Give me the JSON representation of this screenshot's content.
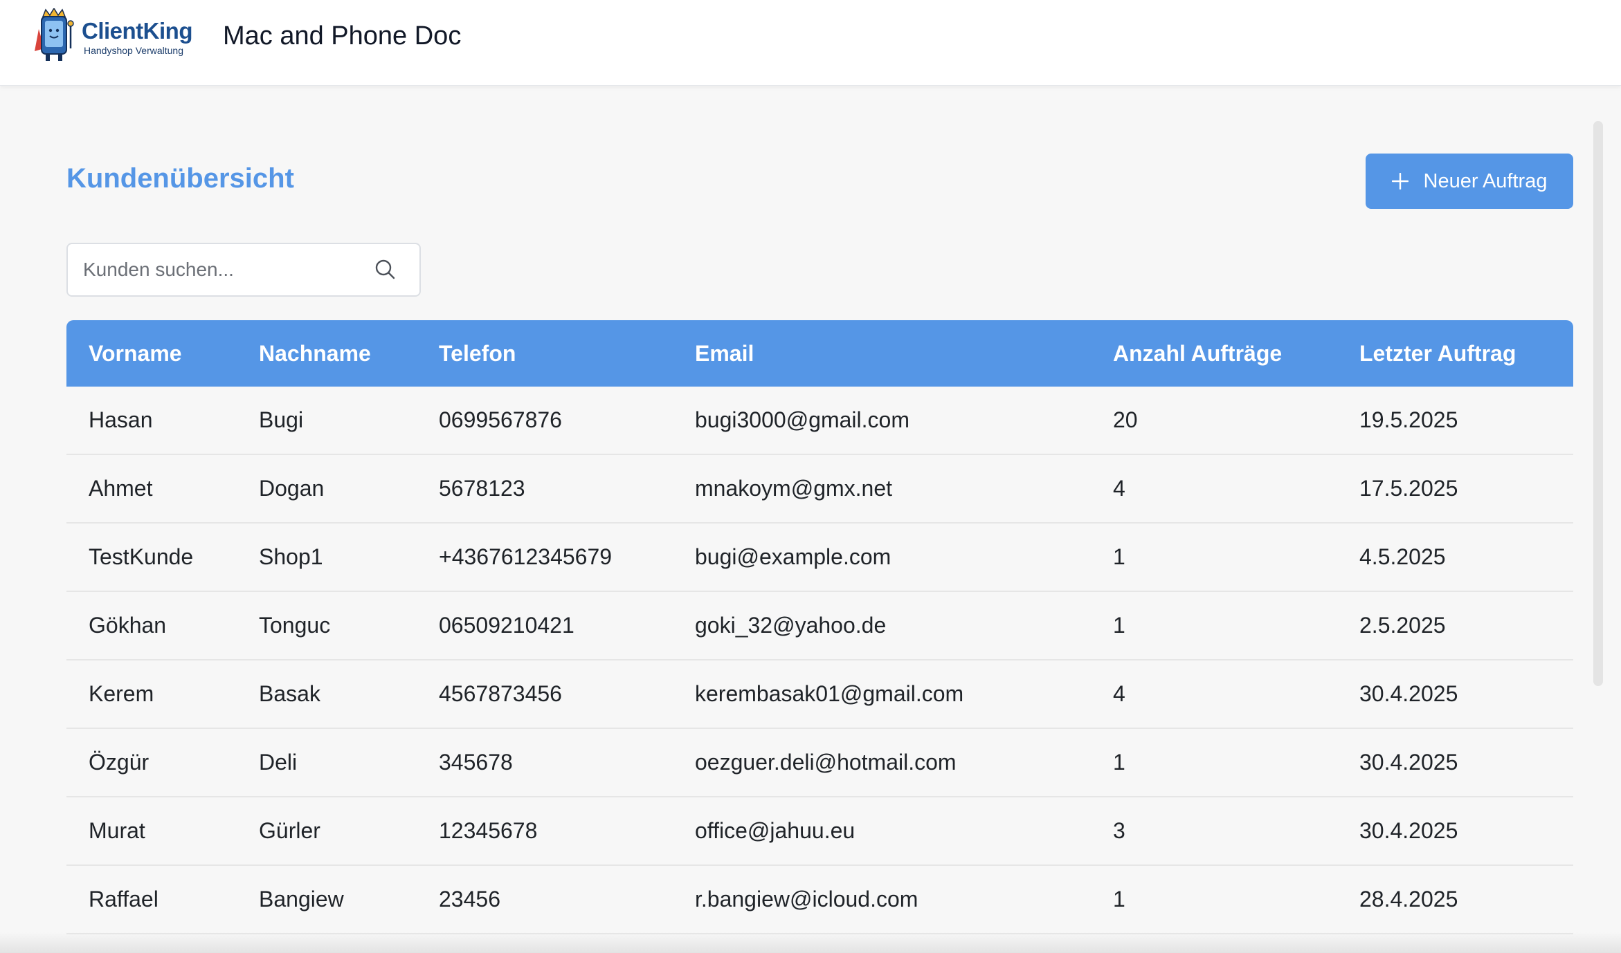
{
  "brand": {
    "name": "ClientKing",
    "tagline": "Handyshop Verwaltung",
    "logo_icon": "crowned-phone-mascot-icon"
  },
  "header": {
    "title": "Mac and Phone Doc"
  },
  "page": {
    "title": "Kundenübersicht",
    "new_order_label": "Neuer Auftrag",
    "new_order_icon": "plus-icon"
  },
  "search": {
    "placeholder": "Kunden suchen...",
    "value": "",
    "icon": "search-icon"
  },
  "table": {
    "columns": [
      "Vorname",
      "Nachname",
      "Telefon",
      "Email",
      "Anzahl Aufträge",
      "Letzter Auftrag"
    ],
    "rows": [
      [
        "Hasan",
        "Bugi",
        "0699567876",
        "bugi3000@gmail.com",
        "20",
        "19.5.2025"
      ],
      [
        "Ahmet",
        "Dogan",
        "5678123",
        "mnakoym@gmx.net",
        "4",
        "17.5.2025"
      ],
      [
        "TestKunde",
        "Shop1",
        "+4367612345679",
        "bugi@example.com",
        "1",
        "4.5.2025"
      ],
      [
        "Gökhan",
        "Tonguc",
        "06509210421",
        "goki_32@yahoo.de",
        "1",
        "2.5.2025"
      ],
      [
        "Kerem",
        "Basak",
        "4567873456",
        "kerembasak01@gmail.com",
        "4",
        "30.4.2025"
      ],
      [
        "Özgür",
        "Deli",
        "345678",
        "oezguer.deli@hotmail.com",
        "1",
        "30.4.2025"
      ],
      [
        "Murat",
        "Gürler",
        "12345678",
        "office@jahuu.eu",
        "3",
        "30.4.2025"
      ],
      [
        "Raffael",
        "Bangiew",
        "23456",
        "r.bangiew@icloud.com",
        "1",
        "28.4.2025"
      ]
    ]
  },
  "colors": {
    "accent": "#5596e6",
    "brand_text": "#1c4f8f",
    "background": "#f7f7f7"
  }
}
